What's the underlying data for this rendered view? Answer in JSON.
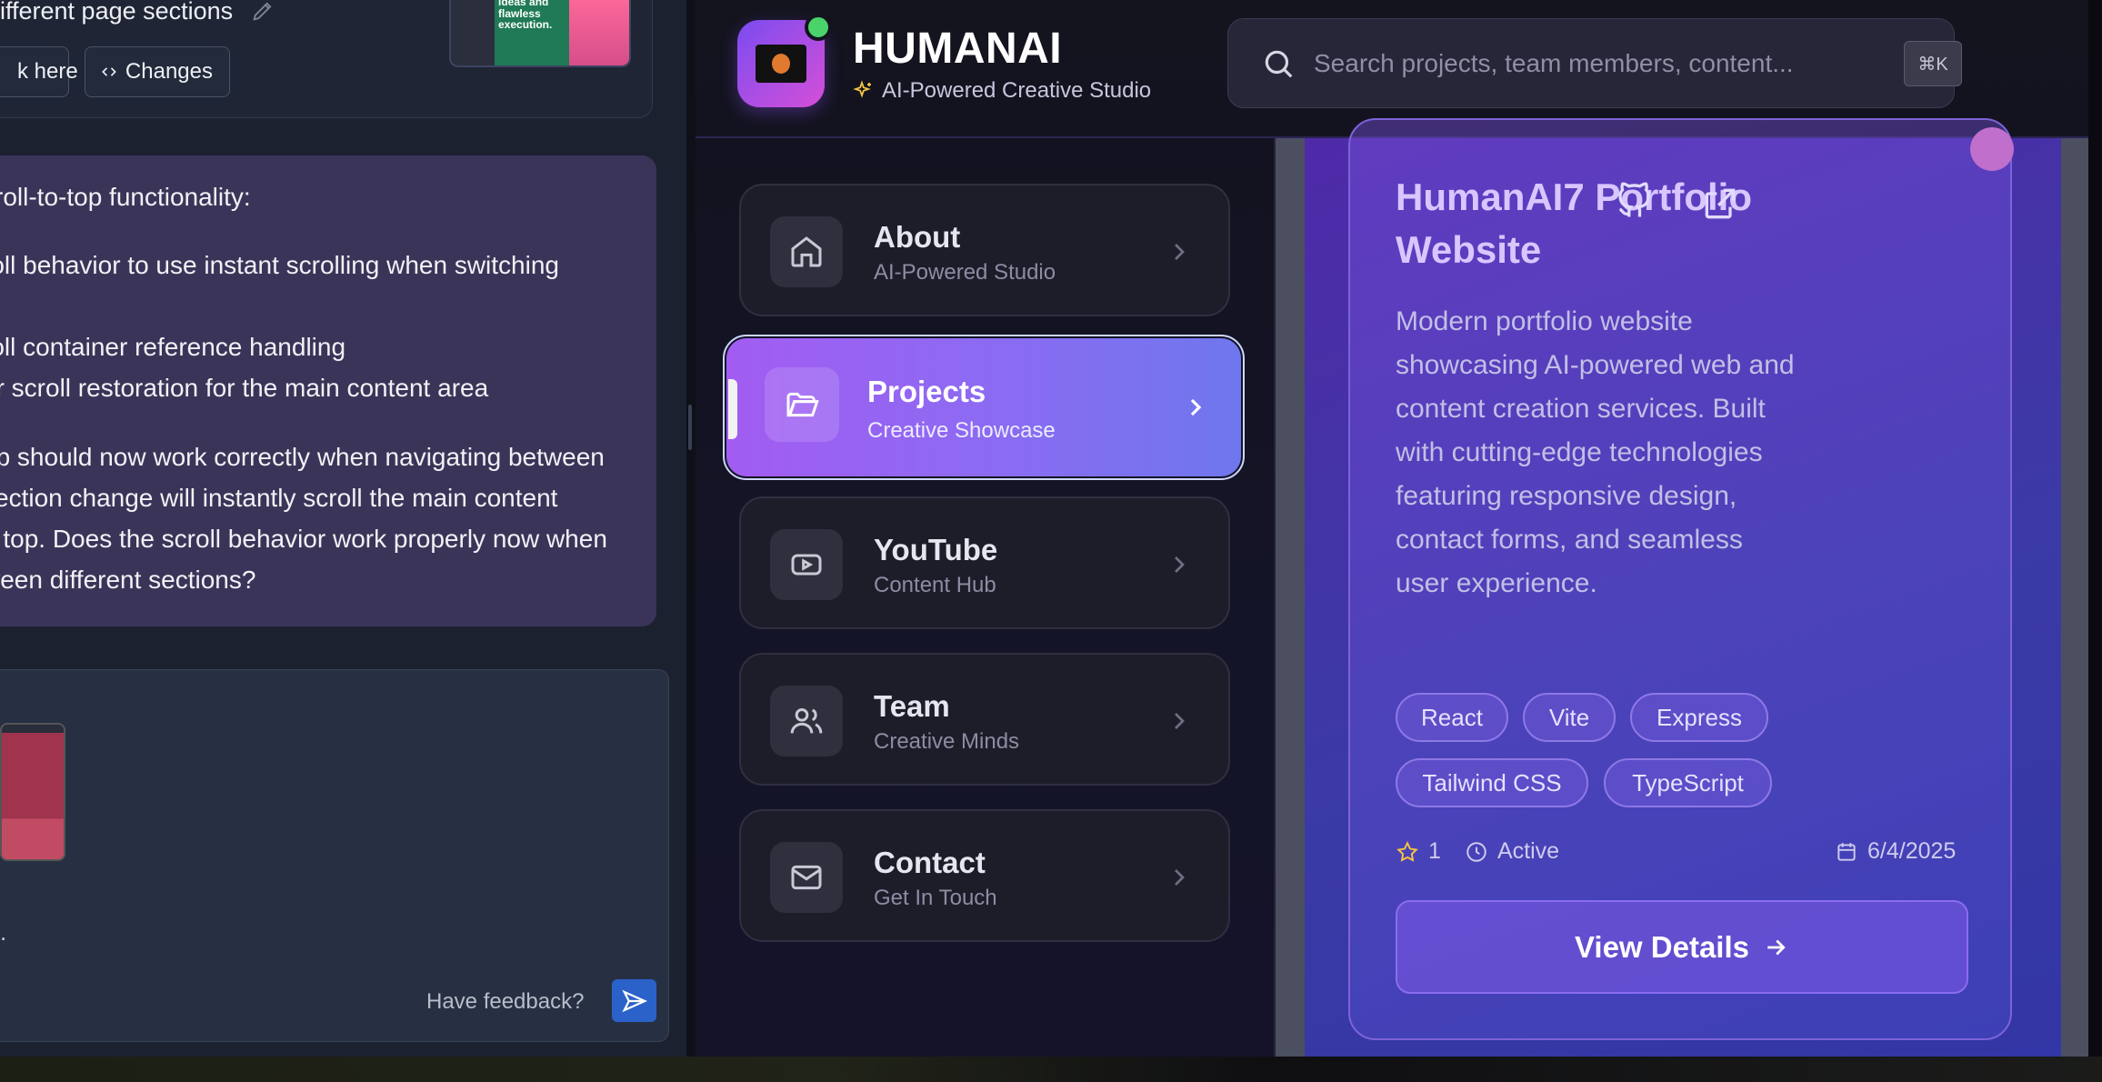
{
  "chat": {
    "message_title": "ifferent page sections",
    "click_here_label": "k here",
    "changes_label": "Changes",
    "thumb_text": "ideas and flawless execution.",
    "ai_lines": [
      "croll-to-top functionality:",
      "roll behavior to use instant scrolling when switching",
      "roll container reference handling",
      "er scroll restoration for the main content area",
      "op should now work correctly when navigating between",
      "section change will instantly scroll the main content",
      "e top. Does the scroll behavior work properly now when",
      "ween different sections?"
    ],
    "composer_dot": ".",
    "feedback_label": "Have feedback?"
  },
  "header": {
    "brand_name": "HUMANAI",
    "brand_subtitle": "AI-Powered Creative Studio",
    "search_placeholder": "Search projects, team members, content...",
    "search_shortcut": "⌘K"
  },
  "nav": {
    "items": [
      {
        "title": "About",
        "subtitle": "AI-Powered Studio",
        "icon": "home-icon"
      },
      {
        "title": "Projects",
        "subtitle": "Creative Showcase",
        "icon": "folder-open-icon",
        "active": true
      },
      {
        "title": "YouTube",
        "subtitle": "Content Hub",
        "icon": "youtube-icon"
      },
      {
        "title": "Team",
        "subtitle": "Creative Minds",
        "icon": "users-icon"
      },
      {
        "title": "Contact",
        "subtitle": "Get In Touch",
        "icon": "mail-icon"
      }
    ]
  },
  "project_card": {
    "title": "HumanAI7 Portfolio Website",
    "description": "Modern portfolio website showcasing AI-powered web and content creation services. Built with cutting-edge technologies featuring responsive design, contact forms, and seamless user experience.",
    "tags": [
      "React",
      "Vite",
      "Express",
      "Tailwind CSS",
      "TypeScript"
    ],
    "stars": "1",
    "status": "Active",
    "date": "6/4/2025",
    "view_button_label": "View Details"
  },
  "colors": {
    "accent_purple": "#a25cf2",
    "accent_indigo": "#6f77ee",
    "status_green": "#4ad36b",
    "send_blue": "#2a62c9"
  }
}
